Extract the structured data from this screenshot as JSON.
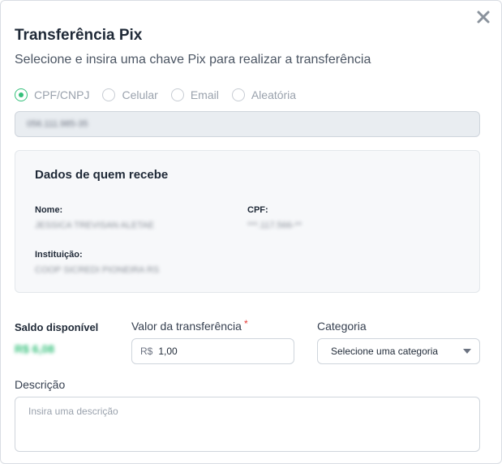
{
  "modal": {
    "title": "Transferência Pix",
    "subtitle": "Selecione e insira uma chave Pix para realizar a transferência",
    "close_icon": "close-icon"
  },
  "key_types": [
    {
      "label": "CPF/CNPJ",
      "checked": true
    },
    {
      "label": "Celular",
      "checked": false
    },
    {
      "label": "Email",
      "checked": false
    },
    {
      "label": "Aleatória",
      "checked": false
    }
  ],
  "key_input": {
    "value": "056.111.985-35"
  },
  "recipient": {
    "title": "Dados de quem recebe",
    "name_label": "Nome:",
    "name_value": "JESSICA TREVISAN ALETAE",
    "cpf_label": "CPF:",
    "cpf_value": "***.117.566-**",
    "institution_label": "Instituição:",
    "institution_value": "COOP SICREDI PIONEIRA RS"
  },
  "balance": {
    "label": "Saldo disponível",
    "value": "R$ 6,08"
  },
  "amount": {
    "label": "Valor da transferência",
    "required_mark": "*",
    "prefix": "R$",
    "value": "1,00"
  },
  "category": {
    "label": "Categoria",
    "selected": "Selecione uma categoria"
  },
  "description": {
    "label": "Descrição",
    "placeholder": "Insira uma descrição"
  },
  "colors": {
    "accent": "#34c07a",
    "required": "#e53935",
    "border": "#cfd5dc"
  }
}
